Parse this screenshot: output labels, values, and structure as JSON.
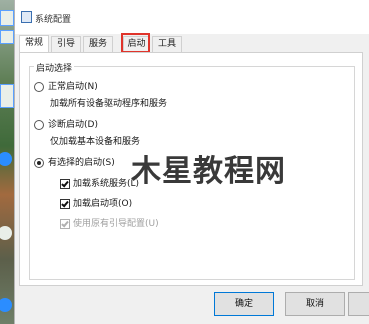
{
  "window": {
    "title": "系统配置"
  },
  "tabs": [
    {
      "label": "常规",
      "active": true
    },
    {
      "label": "引导",
      "active": false
    },
    {
      "label": "服务",
      "active": false
    },
    {
      "label": "启动",
      "active": false,
      "highlighted": true
    },
    {
      "label": "工具",
      "active": false
    }
  ],
  "startup_selection": {
    "legend": "启动选择",
    "options": [
      {
        "label": "正常启动(N)",
        "description": "加载所有设备驱动程序和服务",
        "checked": false
      },
      {
        "label": "诊断启动(D)",
        "description": "仅加载基本设备和服务",
        "checked": false
      },
      {
        "label": "有选择的启动(S)",
        "checked": true
      }
    ],
    "checkboxes": [
      {
        "label": "加载系统服务(L)",
        "checked": true,
        "enabled": true
      },
      {
        "label": "加载启动项(O)",
        "checked": true,
        "enabled": true
      },
      {
        "label": "使用原有引导配置(U)",
        "checked": true,
        "enabled": false
      }
    ]
  },
  "buttons": {
    "ok": "确定",
    "cancel": "取消"
  },
  "watermark": "木星教程网",
  "colors": {
    "highlight": "#e0342b",
    "accent": "#0078d7"
  }
}
